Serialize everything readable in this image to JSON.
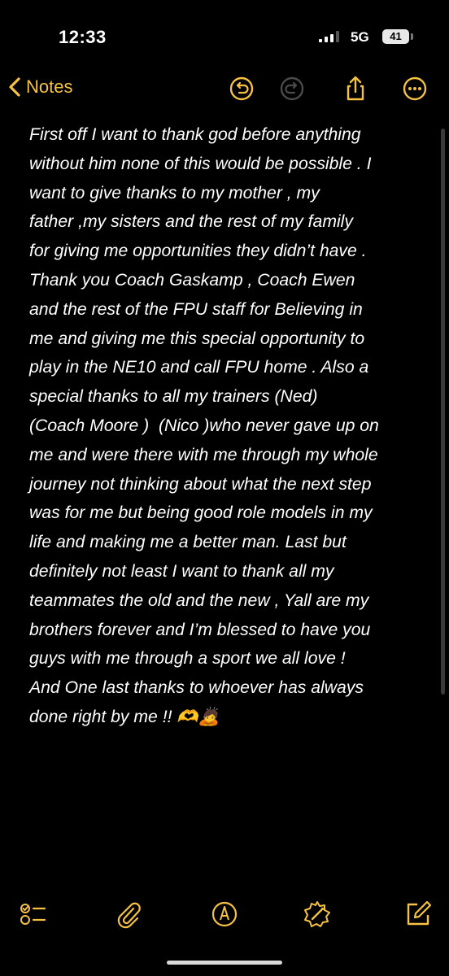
{
  "status_bar": {
    "time": "12:33",
    "network": "5G",
    "battery": "41"
  },
  "nav": {
    "back_label": "Notes",
    "icons": [
      "undo-icon",
      "redo-icon",
      "share-icon",
      "more-icon"
    ]
  },
  "note": {
    "text": "First off I want to thank god before anything\nwithout him none of this would be possible . I\nwant to give thanks to my mother , my\nfather ,my sisters and the rest of my family\nfor giving me opportunities they didn’t have .\nThank you Coach Gaskamp , Coach Ewen\nand the rest of the FPU staff for Believing in\nme and giving me this special opportunity to\nplay in the NE10 and call FPU home . Also a\nspecial thanks to all my trainers (Ned)\n(Coach Moore )  (Nico )who never gave up on\nme and were there with me through my whole\njourney not thinking about what the next step\nwas for me but being good role models in my\nlife and making me a better man. Last but\ndefinitely not least I want to thank all my\nteammates the old and the new , Yall are my\nbrothers forever and I’m blessed to have you\nguys with me through a sport we all love !\nAnd One last thanks to whoever has always\ndone right by me !! 🫶🙇"
  },
  "toolbar": {
    "icons": [
      "checklist-icon",
      "attachment-icon",
      "markup-icon",
      "ai-writing-icon",
      "compose-icon"
    ]
  },
  "colors": {
    "accent": "#f5c242",
    "background": "#000000",
    "text": "#ffffff"
  }
}
